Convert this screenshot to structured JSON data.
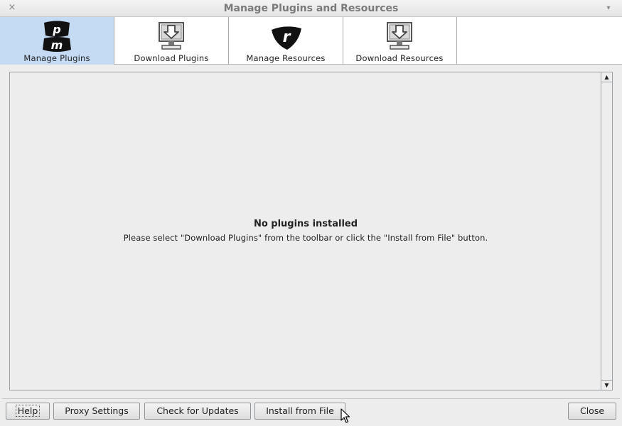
{
  "window": {
    "title": "Manage Plugins and Resources",
    "close_glyph": "×",
    "menu_glyph": "▾"
  },
  "toolbar": {
    "items": [
      {
        "label": "Manage Plugins",
        "icon": "plugin-manager-logo-icon",
        "selected": true
      },
      {
        "label": "Download Plugins",
        "icon": "download-icon",
        "selected": false
      },
      {
        "label": "Manage Resources",
        "icon": "resource-manager-logo-icon",
        "selected": false
      },
      {
        "label": "Download Resources",
        "icon": "download-icon",
        "selected": false
      }
    ]
  },
  "panel": {
    "empty_title": "No plugins installed",
    "empty_message": "Please select \"Download Plugins\" from the toolbar or click the \"Install from File\" button.",
    "scroll_up": "▲",
    "scroll_down": "▼"
  },
  "buttons": {
    "help": "Help",
    "proxy": "Proxy Settings",
    "updates": "Check for Updates",
    "install": "Install from File",
    "close": "Close"
  },
  "colors": {
    "selected_tab": "#c5daf3",
    "background": "#ededed"
  }
}
